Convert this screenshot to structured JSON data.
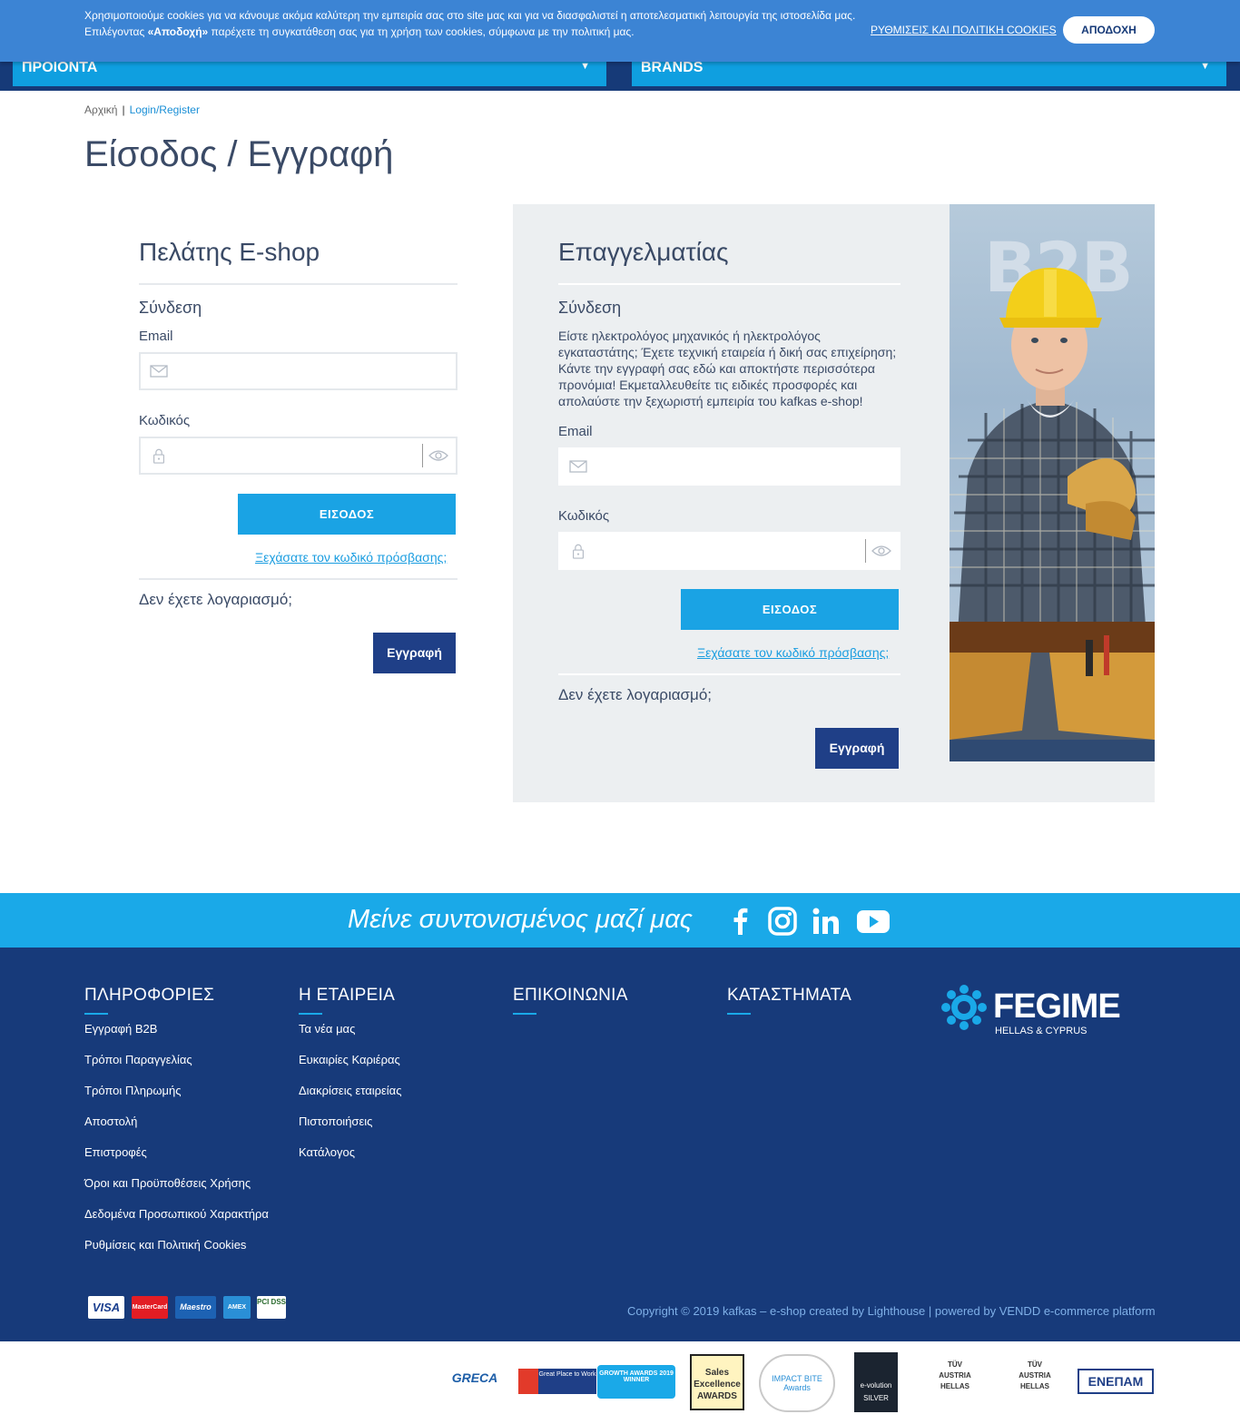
{
  "cookie": {
    "line1": "Χρησιμοποιούμε cookies για να κάνουμε ακόμα καλύτερη την εμπειρία σας στο site μας και για να διασφαλιστεί η αποτελεσματική λειτουργία της ιστοσελίδα μας.",
    "line2_pre": "Επιλέγοντας ",
    "line2_bold": "«Αποδοχή»",
    "line2_post": " παρέχετε τη συγκατάθεση σας για τη χρήση των cookies, σύμφωνα με την πολιτική μας.",
    "settings_link": "ΡΥΘΜΙΣΕΙΣ ΚΑΙ ΠΟΛΙΤΙΚΗ COOKIES",
    "accept_button": "ΑΠΟΔΟΧΗ"
  },
  "nav": {
    "products": "ΠΡΟΙΟΝΤΑ",
    "brands": "BRANDS",
    "caret": "▼"
  },
  "breadcrumb": {
    "home": "Αρχική",
    "separator": "|",
    "current": "Login/Register"
  },
  "page_title": "Είσοδος / Εγγραφή",
  "eshop": {
    "title": "Πελάτης E-shop",
    "login_heading": "Σύνδεση",
    "email_label": "Email",
    "password_label": "Κωδικός",
    "login_button": "ΕΙΣΟΔΟΣ",
    "forgot_link": "Ξεχάσατε τον κωδικό πρόσβασης;",
    "no_account": "Δεν έχετε λογαριασμό;",
    "register_button": "Εγγραφή"
  },
  "b2b": {
    "title": "Επαγγελματίας",
    "login_heading": "Σύνδεση",
    "description": "Είστε ηλεκτρολόγος μηχανικός ή ηλεκτρολόγος εγκαταστάτης; Έχετε τεχνική εταιρεία ή δική σας επιχείρηση; Κάντε την εγγραφή σας εδώ και αποκτήστε περισσότερα προνόμια! Εκμεταλλευθείτε τις ειδικές προσφορές και απολαύστε την ξεχωριστή εμπειρία του kafkas e-shop!",
    "email_label": "Email",
    "password_label": "Κωδικός",
    "login_button": "ΕΙΣΟΔΟΣ",
    "forgot_link": "Ξεχάσατε τον κωδικό πρόσβασης;",
    "no_account": "Δεν έχετε λογαριασμό;",
    "register_button": "Εγγραφή",
    "image_text": "B2B"
  },
  "social": {
    "tagline": "Μείνε συντονισμένος μαζί μας",
    "icons": [
      "facebook-icon",
      "instagram-icon",
      "linkedin-icon",
      "youtube-icon"
    ]
  },
  "footer": {
    "columns": [
      {
        "heading": "ΠΛΗΡΟΦΟΡΙΕΣ",
        "links": [
          "Εγγραφή B2B",
          "Τρόποι Παραγγελίας",
          "Τρόποι Πληρωμής",
          "Αποστολή",
          "Επιστροφές",
          "Όροι και Προϋποθέσεις Χρήσης",
          "Δεδομένα Προσωπικού Χαρακτήρα",
          "Ρυθμίσεις και Πολιτική Cookies"
        ]
      },
      {
        "heading": "Η ΕΤΑΙΡΕΙΑ",
        "links": [
          "Τα νέα μας",
          "Ευκαιρίες Καριέρας",
          "Διακρίσεις εταιρείας",
          "Πιστοποιήσεις",
          "Κατάλογος"
        ]
      },
      {
        "heading": "ΕΠΙΚΟΙΝΩΝΙΑ",
        "links": []
      },
      {
        "heading": "ΚΑΤΑΣΤΗΜΑΤΑ",
        "links": []
      }
    ],
    "brand": {
      "name": "FEGIME",
      "sub": "HELLAS & CYPRUS"
    },
    "payments": [
      "VISA",
      "MasterCard",
      "Maestro",
      "AMEX",
      "PCI DSS"
    ],
    "copyright": "Copyright © 2019 kafkas – e-shop created by Lighthouse | powered by VENDD e-commerce platform"
  },
  "badges": [
    "GRECA",
    "Great Place to Work",
    "GROWTH AWARDS 2019 WINNER",
    "Sales Excellence AWARDS",
    "IMPACT BITE Awards",
    "e-volution SILVER",
    "TÜV AUSTRIA HELLAS",
    "TÜV AUSTRIA HELLAS",
    "ΕΝΕΠΑΜ"
  ],
  "colors": {
    "primary_blue": "#1aa3e4",
    "navy": "#173a7a",
    "register_blue": "#1f3f87",
    "cookie_bar": "#3c84d4"
  }
}
